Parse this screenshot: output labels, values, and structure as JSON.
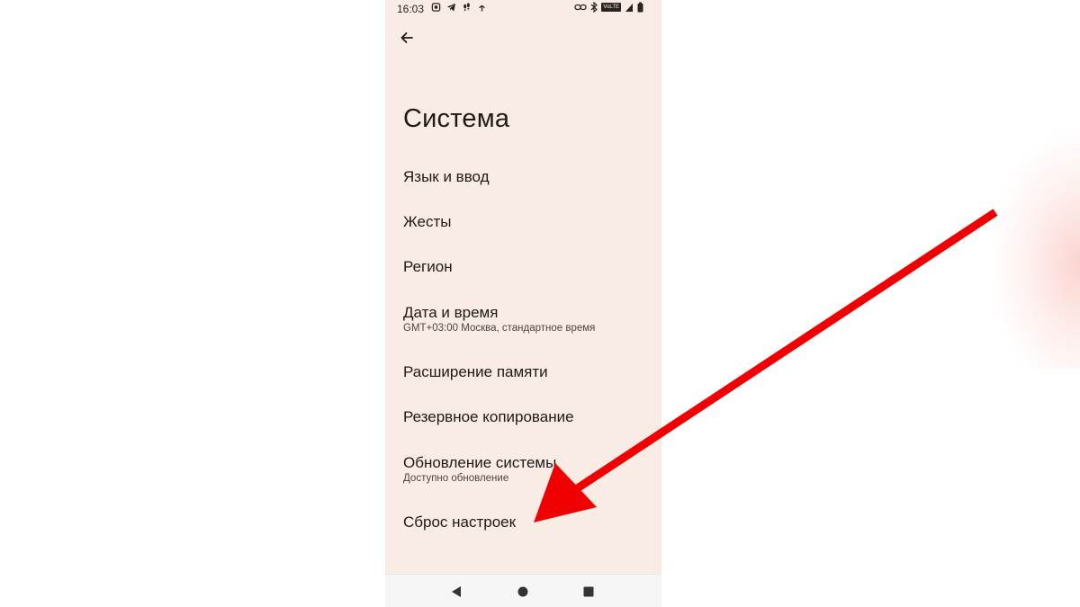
{
  "status_bar": {
    "time": "16:03",
    "left_icons": [
      "notification-icon",
      "telegram-icon",
      "footsteps-icon",
      "signal-icon"
    ],
    "right_icons": [
      "link-icon",
      "bluetooth-icon",
      "volte-icon",
      "signal-bars-icon",
      "battery-icon"
    ],
    "volte_label": "VoLTE"
  },
  "header": {
    "back_icon": "arrow-back-icon"
  },
  "title": "Система",
  "menu": [
    {
      "label": "Язык и ввод"
    },
    {
      "label": "Жесты"
    },
    {
      "label": "Регион"
    },
    {
      "label": "Дата и время",
      "sub": "GMT+03:00 Москва, стандартное время"
    },
    {
      "label": "Расширение памяти"
    },
    {
      "label": "Резервное копирование"
    },
    {
      "label": "Обновление системы",
      "sub": "Доступно обновление"
    },
    {
      "label": "Сброс настроек"
    }
  ],
  "nav_bar": {
    "icons": [
      "back-triangle-icon",
      "home-circle-icon",
      "recents-square-icon"
    ]
  },
  "annotation": {
    "arrow_color": "#f00000",
    "points_to": "Сброс настроек"
  },
  "colors": {
    "screen_bg": "#f8ece4",
    "text": "#201a17",
    "nav_bg": "#f5f5f5"
  }
}
